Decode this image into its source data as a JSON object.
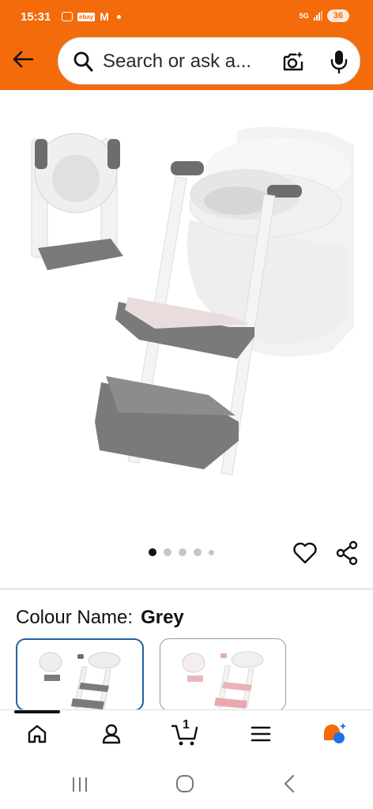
{
  "status_bar": {
    "time": "15:31",
    "network": "5G",
    "battery": "36",
    "left_icons": [
      "screen-record-icon",
      "ebay-icon",
      "gmail-icon",
      "notification-dot"
    ]
  },
  "search": {
    "placeholder": "Search or ask a..."
  },
  "product": {
    "image_alt": "Grey potty training ladder seat",
    "image_count": 5,
    "active_image_index": 0
  },
  "variation": {
    "label": "Colour Name:",
    "selected": "Grey",
    "options": [
      {
        "name": "Grey",
        "selected": true
      },
      {
        "name": "Pink",
        "selected": false
      }
    ]
  },
  "bottom_nav": {
    "items": [
      "home",
      "account",
      "cart",
      "menu",
      "assistant"
    ],
    "cart_count": "1",
    "active": "home"
  },
  "colors": {
    "header": "#f36b0a",
    "selected_border": "#2162a1",
    "assistant_orange": "#f36b0a",
    "assistant_blue": "#1a73e8"
  }
}
